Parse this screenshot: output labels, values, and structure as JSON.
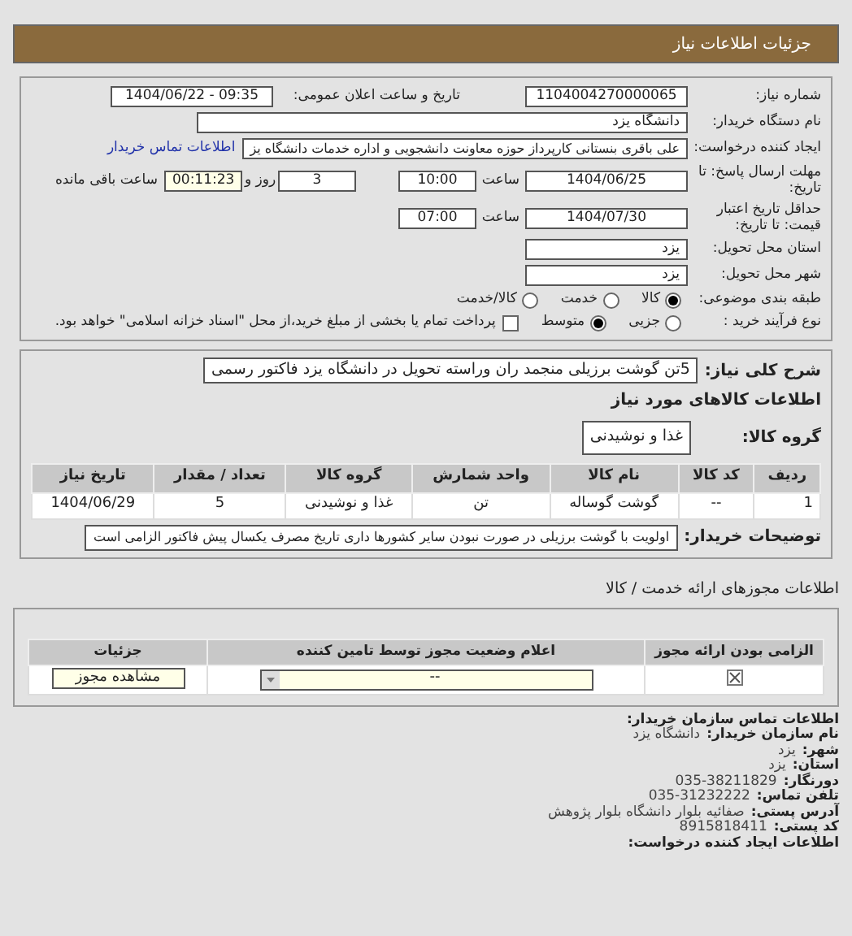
{
  "header": {
    "title": "جزئیات اطلاعات نیاز"
  },
  "need": {
    "number_label": "شماره نیاز:",
    "number": "1104004270000065",
    "announce_label": "تاریخ و ساعت اعلان عمومی:",
    "announce": "1404/06/22 - 09:35"
  },
  "buyer": {
    "label": "نام دستگاه خریدار:",
    "value": "دانشگاه یزد"
  },
  "requester": {
    "label": "ایجاد کننده درخواست:",
    "value": "علی باقری بنستانی کارپرداز حوزه معاونت دانشجویی و اداره خدمات دانشگاه یز",
    "link": "اطلاعات تماس خریدار"
  },
  "deadline": {
    "label": "مهلت ارسال پاسخ: تا تاریخ:",
    "date": "1404/06/25",
    "time_label": "ساعت",
    "time": "10:00",
    "days": "3",
    "days_label": "روز و",
    "remaining": "00:11:23",
    "remaining_label": "ساعت باقی مانده"
  },
  "validity": {
    "label": "حداقل تاریخ اعتبار قیمت: تا تاریخ:",
    "date": "1404/07/30",
    "time_label": "ساعت",
    "time": "07:00"
  },
  "province": {
    "label": "استان محل تحویل:",
    "value": "یزد"
  },
  "city": {
    "label": "شهر محل تحویل:",
    "value": "یزد"
  },
  "category": {
    "label": "طبقه بندی موضوعی:",
    "options": [
      {
        "label": "کالا",
        "selected": true
      },
      {
        "label": "خدمت",
        "selected": false
      },
      {
        "label": "کالا/خدمت",
        "selected": false
      }
    ]
  },
  "process": {
    "label": "نوع فرآیند خرید :",
    "options": [
      {
        "label": "جزیی",
        "selected": false
      },
      {
        "label": "متوسط",
        "selected": true
      }
    ],
    "payment_checked": false,
    "payment_text": "پرداخت تمام یا بخشی از مبلغ خرید،از محل \"اسناد خزانه اسلامی\" خواهد بود."
  },
  "description": {
    "label": "شرح کلی نیاز:",
    "value": "5تن گوشت برزیلی منجمد ران وراسته تحویل در دانشگاه یزد فاکتور رسمی"
  },
  "goods": {
    "title": "اطلاعات کالاهای مورد نیاز",
    "group_label": "گروه کالا:",
    "group": "غذا و نوشیدنی",
    "columns": [
      "ردیف",
      "کد کالا",
      "نام کالا",
      "واحد شمارش",
      "گروه کالا",
      "تعداد / مقدار",
      "تاریخ نیاز"
    ],
    "rows": [
      [
        "1",
        "--",
        "گوشت گوساله",
        "تن",
        "غذا و نوشیدنی",
        "5",
        "1404/06/29"
      ]
    ]
  },
  "notes": {
    "label": "توضیحات خریدار:",
    "value": "اولویت با گوشت برزیلی در صورت نبودن سایر کشورها داری تاریخ مصرف یکسال پیش فاکتور الزامی است"
  },
  "licenses": {
    "title": "اطلاعات مجوزهای ارائه خدمت / کالا",
    "columns": [
      "الزامی بودن ارائه مجوز",
      "اعلام وضعیت مجوز توسط تامین کننده",
      "جزئیات"
    ],
    "rows": [
      {
        "required": true,
        "status": "--",
        "button": "مشاهده مجوز"
      }
    ]
  },
  "contact": [
    {
      "kind": "heading",
      "label": "اطلاعات تماس سازمان خریدار:"
    },
    {
      "kind": "pair",
      "label": "نام سازمان خریدار:",
      "value": "دانشگاه یزد"
    },
    {
      "kind": "pair",
      "label": "شهر:",
      "value": "یزد"
    },
    {
      "kind": "pair",
      "label": "استان:",
      "value": "یزد"
    },
    {
      "kind": "pair",
      "label": "دورنگار:",
      "value": "035-38211829"
    },
    {
      "kind": "pair",
      "label": "تلفن تماس:",
      "value": "035-31232222"
    },
    {
      "kind": "pair",
      "label": "آدرس پستی:",
      "value": "صفائیه بلوار دانشگاه بلوار پژوهش"
    },
    {
      "kind": "pair",
      "label": "کد پستی:",
      "value": "8915818411"
    },
    {
      "kind": "heading",
      "label": "اطلاعات ایجاد کننده درخواست:"
    }
  ]
}
